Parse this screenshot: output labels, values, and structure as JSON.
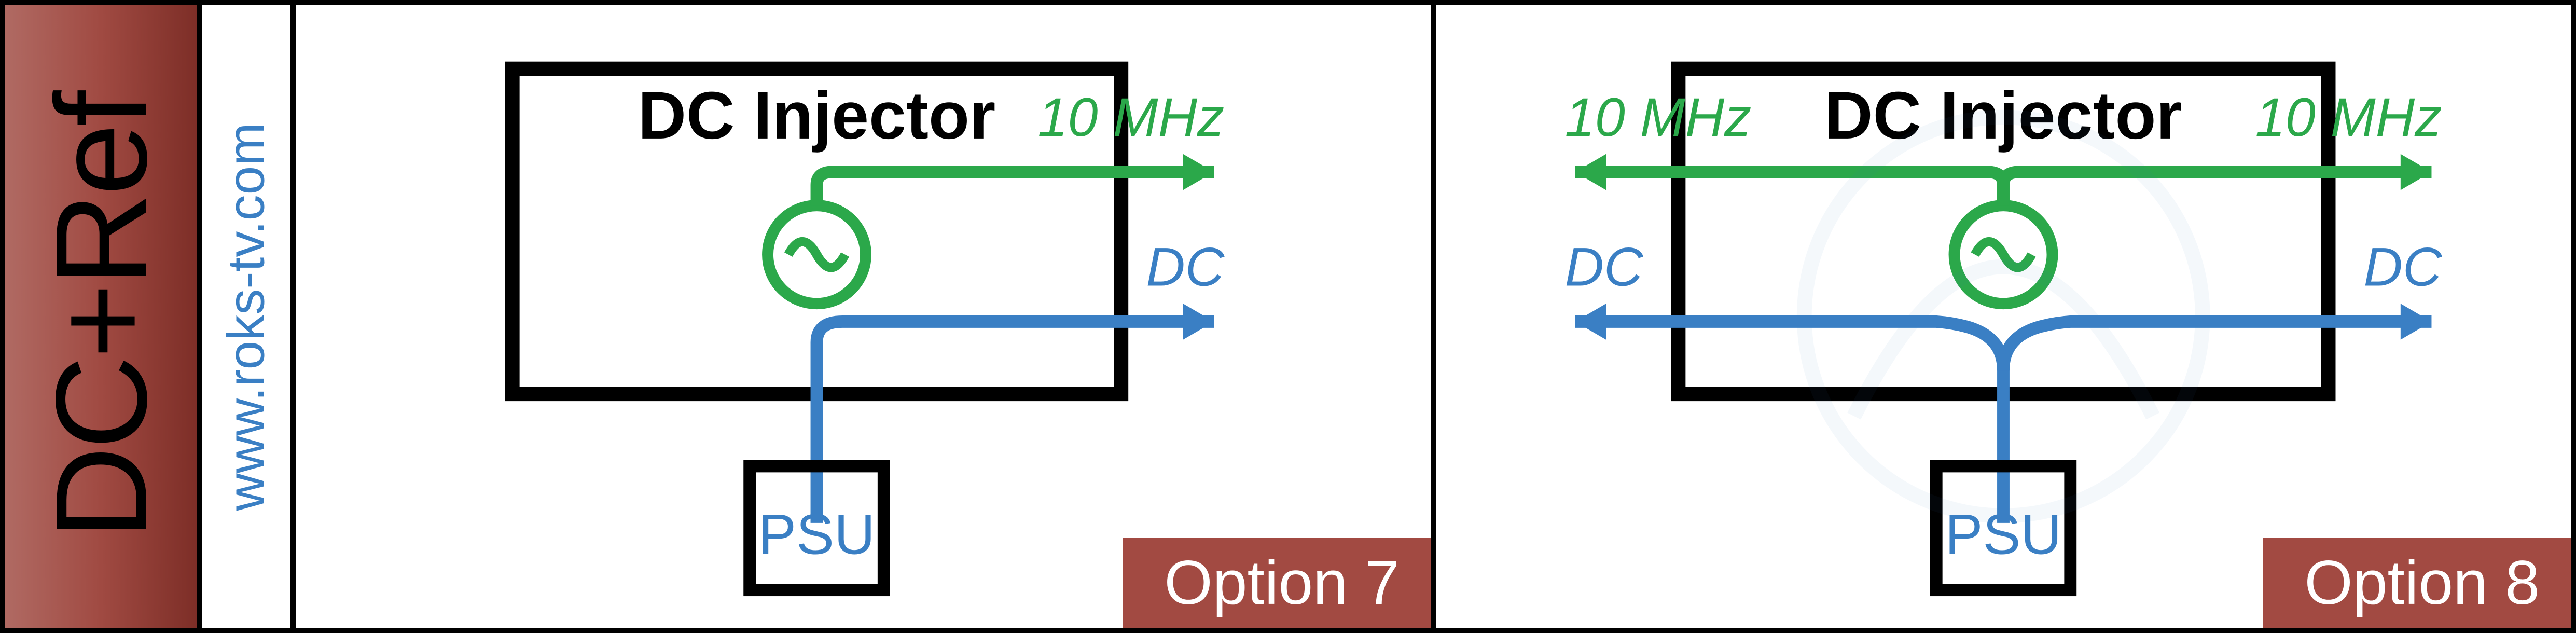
{
  "side_label": "DC+Ref",
  "url": "www.roks-tv.com",
  "colors": {
    "green": "#2ba84a",
    "blue": "#3a7fc4",
    "black": "#000",
    "brown": "#a24a42"
  },
  "panels": [
    {
      "key": "opt7",
      "title": "DC Injector",
      "psu": "PSU",
      "freq_right": "10 MHz",
      "dc_right": "DC",
      "option_label": "Option 7",
      "dual_output": false
    },
    {
      "key": "opt8",
      "title": "DC Injector",
      "psu": "PSU",
      "freq_right": "10 MHz",
      "freq_left": "10 MHz",
      "dc_right": "DC",
      "dc_left": "DC",
      "option_label": "Option 8",
      "dual_output": true
    }
  ]
}
